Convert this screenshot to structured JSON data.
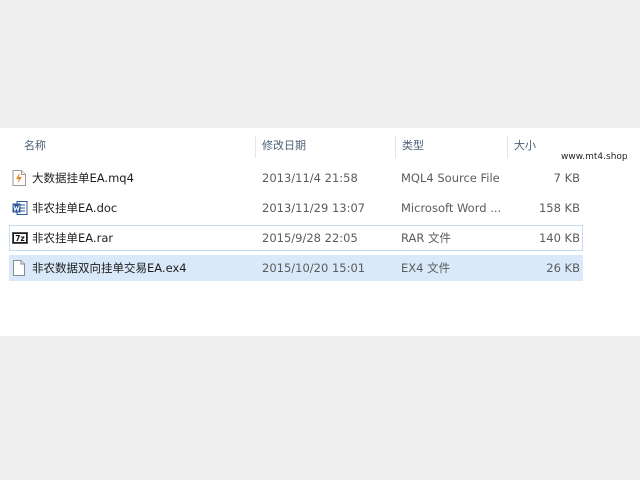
{
  "header": {
    "col_name": "名称",
    "col_date": "修改日期",
    "col_type": "类型",
    "col_size": "大小"
  },
  "watermark": "www.mt4.shop",
  "files": [
    {
      "name": "大数据挂单EA.mq4",
      "date": "2013/11/4 21:58",
      "type": "MQL4 Source File",
      "size": "7 KB",
      "icon": "mq4-file-icon"
    },
    {
      "name": "非农挂单EA.doc",
      "date": "2013/11/29 13:07",
      "type": "Microsoft Word ...",
      "size": "158 KB",
      "icon": "word-doc-icon"
    },
    {
      "name": "非农挂单EA.rar",
      "date": "2015/9/28 22:05",
      "type": "RAR 文件",
      "size": "140 KB",
      "icon": "7zip-archive-icon"
    },
    {
      "name": "非农数据双向挂单交易EA.ex4",
      "date": "2015/10/20 15:01",
      "type": "EX4 文件",
      "size": "26 KB",
      "icon": "blank-file-icon"
    }
  ],
  "colors": {
    "selection": "#d9e9fa",
    "selection_border": "#c5dbf2",
    "header_text": "#4c607a"
  }
}
